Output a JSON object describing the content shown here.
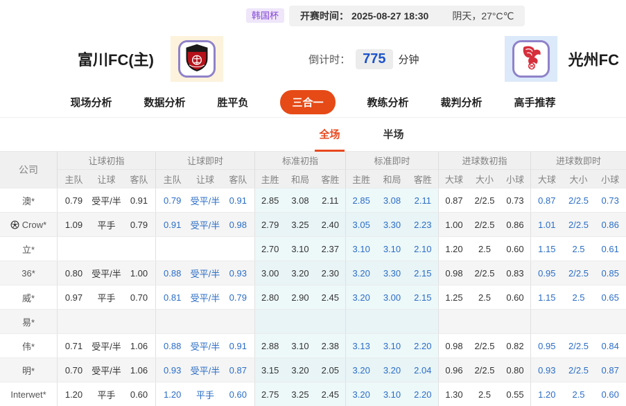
{
  "top_bar": {
    "league": "韩国杯",
    "kickoff_label": "开赛时间：",
    "kickoff_time": "2025-08-27 18:30",
    "weather": "阴天，27°C℃"
  },
  "match": {
    "home_name": "富川FC(主)",
    "away_name": "光州FC",
    "countdown_label": "倒计时：",
    "countdown_value": "775",
    "countdown_unit": "分钟"
  },
  "nav": {
    "tabs": [
      {
        "label": "现场分析",
        "active": false
      },
      {
        "label": "数据分析",
        "active": false
      },
      {
        "label": "胜平负",
        "active": false
      },
      {
        "label": "三合一",
        "active": true
      },
      {
        "label": "教练分析",
        "active": false
      },
      {
        "label": "裁判分析",
        "active": false
      },
      {
        "label": "高手推荐",
        "active": false
      }
    ]
  },
  "subtabs": {
    "full": "全场",
    "half": "半场"
  },
  "colors": {
    "accent_orange": "#e64a17",
    "odds_blue": "#2a6dc7",
    "countdown_blue": "#1d53cb",
    "league_purple": "#8247d6",
    "cyan_column": "#edf8f9"
  },
  "table": {
    "company_header": "公司",
    "groups": [
      {
        "label": "让球初指",
        "cols": [
          "主队",
          "让球",
          "客队"
        ],
        "live": false,
        "cyan": false
      },
      {
        "label": "让球即时",
        "cols": [
          "主队",
          "让球",
          "客队"
        ],
        "live": true,
        "cyan": false
      },
      {
        "label": "标准初指",
        "cols": [
          "主胜",
          "和局",
          "客胜"
        ],
        "live": false,
        "cyan": true
      },
      {
        "label": "标准即时",
        "cols": [
          "主胜",
          "和局",
          "客胜"
        ],
        "live": true,
        "cyan": true
      },
      {
        "label": "进球数初指",
        "cols": [
          "大球",
          "大小",
          "小球"
        ],
        "live": false,
        "cyan": false
      },
      {
        "label": "进球数即时",
        "cols": [
          "大球",
          "大小",
          "小球"
        ],
        "live": true,
        "cyan": false
      }
    ],
    "rows": [
      {
        "company": "澳*",
        "has_icon": false,
        "cells": [
          [
            "0.79",
            "受平/半",
            "0.91"
          ],
          [
            "0.79",
            "受平/半",
            "0.91"
          ],
          [
            "2.85",
            "3.08",
            "2.11"
          ],
          [
            "2.85",
            "3.08",
            "2.11"
          ],
          [
            "0.87",
            "2/2.5",
            "0.73"
          ],
          [
            "0.87",
            "2/2.5",
            "0.73"
          ]
        ]
      },
      {
        "company": "Crow*",
        "has_icon": true,
        "cells": [
          [
            "1.09",
            "平手",
            "0.79"
          ],
          [
            "0.91",
            "受平/半",
            "0.98"
          ],
          [
            "2.79",
            "3.25",
            "2.40"
          ],
          [
            "3.05",
            "3.30",
            "2.23"
          ],
          [
            "1.00",
            "2/2.5",
            "0.86"
          ],
          [
            "1.01",
            "2/2.5",
            "0.86"
          ]
        ]
      },
      {
        "company": "立*",
        "has_icon": false,
        "cells": [
          [
            "",
            "",
            ""
          ],
          [
            "",
            "",
            ""
          ],
          [
            "2.70",
            "3.10",
            "2.37"
          ],
          [
            "3.10",
            "3.10",
            "2.10"
          ],
          [
            "1.20",
            "2.5",
            "0.60"
          ],
          [
            "1.15",
            "2.5",
            "0.61"
          ]
        ]
      },
      {
        "company": "36*",
        "has_icon": false,
        "cells": [
          [
            "0.80",
            "受平/半",
            "1.00"
          ],
          [
            "0.88",
            "受平/半",
            "0.93"
          ],
          [
            "3.00",
            "3.20",
            "2.30"
          ],
          [
            "3.20",
            "3.30",
            "2.15"
          ],
          [
            "0.98",
            "2/2.5",
            "0.83"
          ],
          [
            "0.95",
            "2/2.5",
            "0.85"
          ]
        ]
      },
      {
        "company": "威*",
        "has_icon": false,
        "cells": [
          [
            "0.97",
            "平手",
            "0.70"
          ],
          [
            "0.81",
            "受平/半",
            "0.79"
          ],
          [
            "2.80",
            "2.90",
            "2.45"
          ],
          [
            "3.20",
            "3.00",
            "2.15"
          ],
          [
            "1.25",
            "2.5",
            "0.60"
          ],
          [
            "1.15",
            "2.5",
            "0.65"
          ]
        ]
      },
      {
        "company": "易*",
        "has_icon": false,
        "cells": [
          [
            "",
            "",
            ""
          ],
          [
            "",
            "",
            ""
          ],
          [
            "",
            "",
            ""
          ],
          [
            "",
            "",
            ""
          ],
          [
            "",
            "",
            ""
          ],
          [
            "",
            "",
            ""
          ]
        ]
      },
      {
        "company": "伟*",
        "has_icon": false,
        "cells": [
          [
            "0.71",
            "受平/半",
            "1.06"
          ],
          [
            "0.88",
            "受平/半",
            "0.91"
          ],
          [
            "2.88",
            "3.10",
            "2.38"
          ],
          [
            "3.13",
            "3.10",
            "2.20"
          ],
          [
            "0.98",
            "2/2.5",
            "0.82"
          ],
          [
            "0.95",
            "2/2.5",
            "0.84"
          ]
        ]
      },
      {
        "company": "明*",
        "has_icon": false,
        "cells": [
          [
            "0.70",
            "受平/半",
            "1.06"
          ],
          [
            "0.93",
            "受平/半",
            "0.87"
          ],
          [
            "3.15",
            "3.20",
            "2.05"
          ],
          [
            "3.20",
            "3.20",
            "2.04"
          ],
          [
            "0.96",
            "2/2.5",
            "0.80"
          ],
          [
            "0.93",
            "2/2.5",
            "0.87"
          ]
        ]
      },
      {
        "company": "Interwet*",
        "has_icon": false,
        "cells": [
          [
            "1.20",
            "平手",
            "0.60"
          ],
          [
            "1.20",
            "平手",
            "0.60"
          ],
          [
            "2.75",
            "3.25",
            "2.45"
          ],
          [
            "3.20",
            "3.10",
            "2.20"
          ],
          [
            "1.30",
            "2.5",
            "0.55"
          ],
          [
            "1.20",
            "2.5",
            "0.60"
          ]
        ]
      }
    ]
  }
}
